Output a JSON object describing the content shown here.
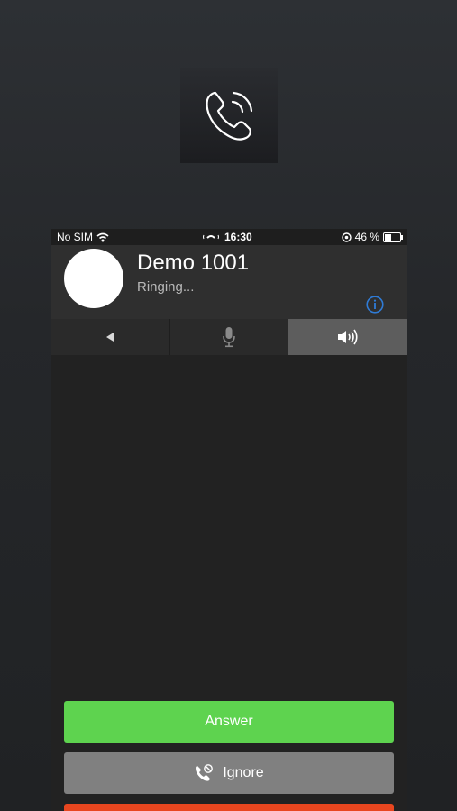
{
  "status_bar": {
    "carrier": "No SIM",
    "time": "16:30",
    "battery": "46 %",
    "battery_level": 0.46
  },
  "caller": {
    "name": "Demo 1001",
    "status": "Ringing..."
  },
  "controls": [
    {
      "name": "back",
      "icon": "triangle-left-icon",
      "active": false
    },
    {
      "name": "mute",
      "icon": "microphone-icon",
      "active": false
    },
    {
      "name": "speaker",
      "icon": "speaker-icon",
      "active": true
    }
  ],
  "actions": {
    "answer_label": "Answer",
    "ignore_label": "Ignore"
  },
  "colors": {
    "answer": "#5ed34f",
    "ignore": "#808080",
    "decline": "#e8461f",
    "info": "#2f7bd6"
  }
}
